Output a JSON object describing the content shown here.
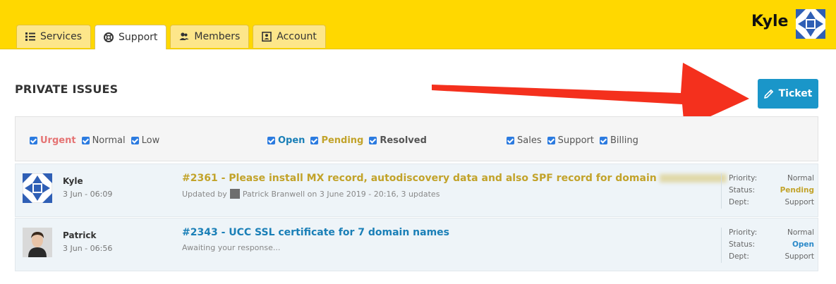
{
  "header": {
    "tabs": [
      {
        "label": "Services",
        "icon": "list-icon",
        "active": false
      },
      {
        "label": "Support",
        "icon": "lifebuoy-icon",
        "active": true
      },
      {
        "label": "Members",
        "icon": "users-icon",
        "active": false
      },
      {
        "label": "Account",
        "icon": "id-card-icon",
        "active": false
      }
    ],
    "user_name": "Kyle",
    "colors": {
      "bar": "#ffd800",
      "tab": "#fde68a"
    }
  },
  "main": {
    "title": "PRIVATE ISSUES",
    "ticket_button": {
      "label": "Ticket",
      "icon": "pencil-icon",
      "color": "#1a96c9"
    }
  },
  "filters": {
    "priority": [
      {
        "label": "Urgent",
        "checked": true,
        "color": "#e57373"
      },
      {
        "label": "Normal",
        "checked": true,
        "color": "#555555"
      },
      {
        "label": "Low",
        "checked": true,
        "color": "#555555"
      }
    ],
    "status": [
      {
        "label": "Open",
        "checked": true,
        "color": "#1a7fb7"
      },
      {
        "label": "Pending",
        "checked": true,
        "color": "#c2a32a"
      },
      {
        "label": "Resolved",
        "checked": true,
        "color": "#555555"
      }
    ],
    "dept": [
      {
        "label": "Sales",
        "checked": true
      },
      {
        "label": "Support",
        "checked": true
      },
      {
        "label": "Billing",
        "checked": true
      }
    ]
  },
  "issues": [
    {
      "author": "Kyle",
      "date": "3 Jun - 06:09",
      "title": "#2361 - Please install MX record, autodiscovery data and also SPF record for domain",
      "title_color": "#c2a32a",
      "sub_prefix": "Updated by",
      "sub_text": "Patrick Branwell on 3 June 2019 - 20:16, 3 updates",
      "priority_label": "Priority:",
      "priority": "Normal",
      "status_label": "Status:",
      "status": "Pending",
      "status_color": "#c2a32a",
      "dept_label": "Dept:",
      "dept": "Support"
    },
    {
      "author": "Patrick",
      "date": "3 Jun - 06:56",
      "title": "#2343 - UCC SSL certificate for 7 domain names",
      "title_color": "#1a7fb7",
      "sub_text": "Awaiting your response...",
      "priority_label": "Priority:",
      "priority": "Normal",
      "status_label": "Status:",
      "status": "Open",
      "status_color": "#2a88c8",
      "dept_label": "Dept:",
      "dept": "Support"
    }
  ]
}
